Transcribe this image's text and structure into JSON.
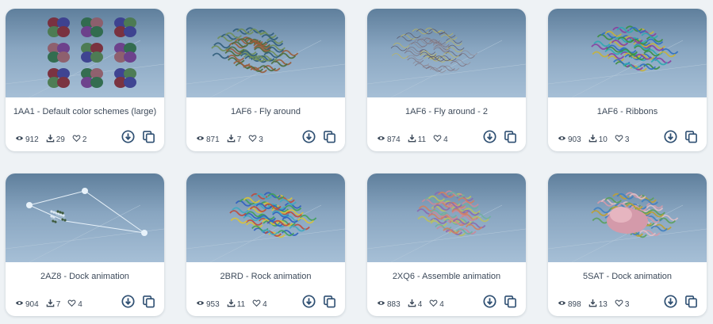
{
  "colors": {
    "accent": "#2e4f72",
    "text": "#3d4a5a",
    "background": "#eef2f5"
  },
  "icons": {
    "views": "eye-icon",
    "downloads": "download-count-icon",
    "likes": "heart-icon",
    "download_action": "download-circle-icon",
    "copy_action": "copy-icon"
  },
  "cards": [
    {
      "title": "1AA1 - Default color schemes (large)",
      "views": "912",
      "downloads": "29",
      "likes": "2"
    },
    {
      "title": "1AF6 - Fly around",
      "views": "871",
      "downloads": "7",
      "likes": "3"
    },
    {
      "title": "1AF6 - Fly around - 2",
      "views": "874",
      "downloads": "11",
      "likes": "4"
    },
    {
      "title": "1AF6 - Ribbons",
      "views": "903",
      "downloads": "10",
      "likes": "3"
    },
    {
      "title": "2AZ8 - Dock animation",
      "views": "904",
      "downloads": "7",
      "likes": "4"
    },
    {
      "title": "2BRD - Rock animation",
      "views": "953",
      "downloads": "11",
      "likes": "4"
    },
    {
      "title": "2XQ6 - Assemble animation",
      "views": "883",
      "downloads": "4",
      "likes": "4"
    },
    {
      "title": "5SAT - Dock animation",
      "views": "898",
      "downloads": "13",
      "likes": "3"
    }
  ]
}
